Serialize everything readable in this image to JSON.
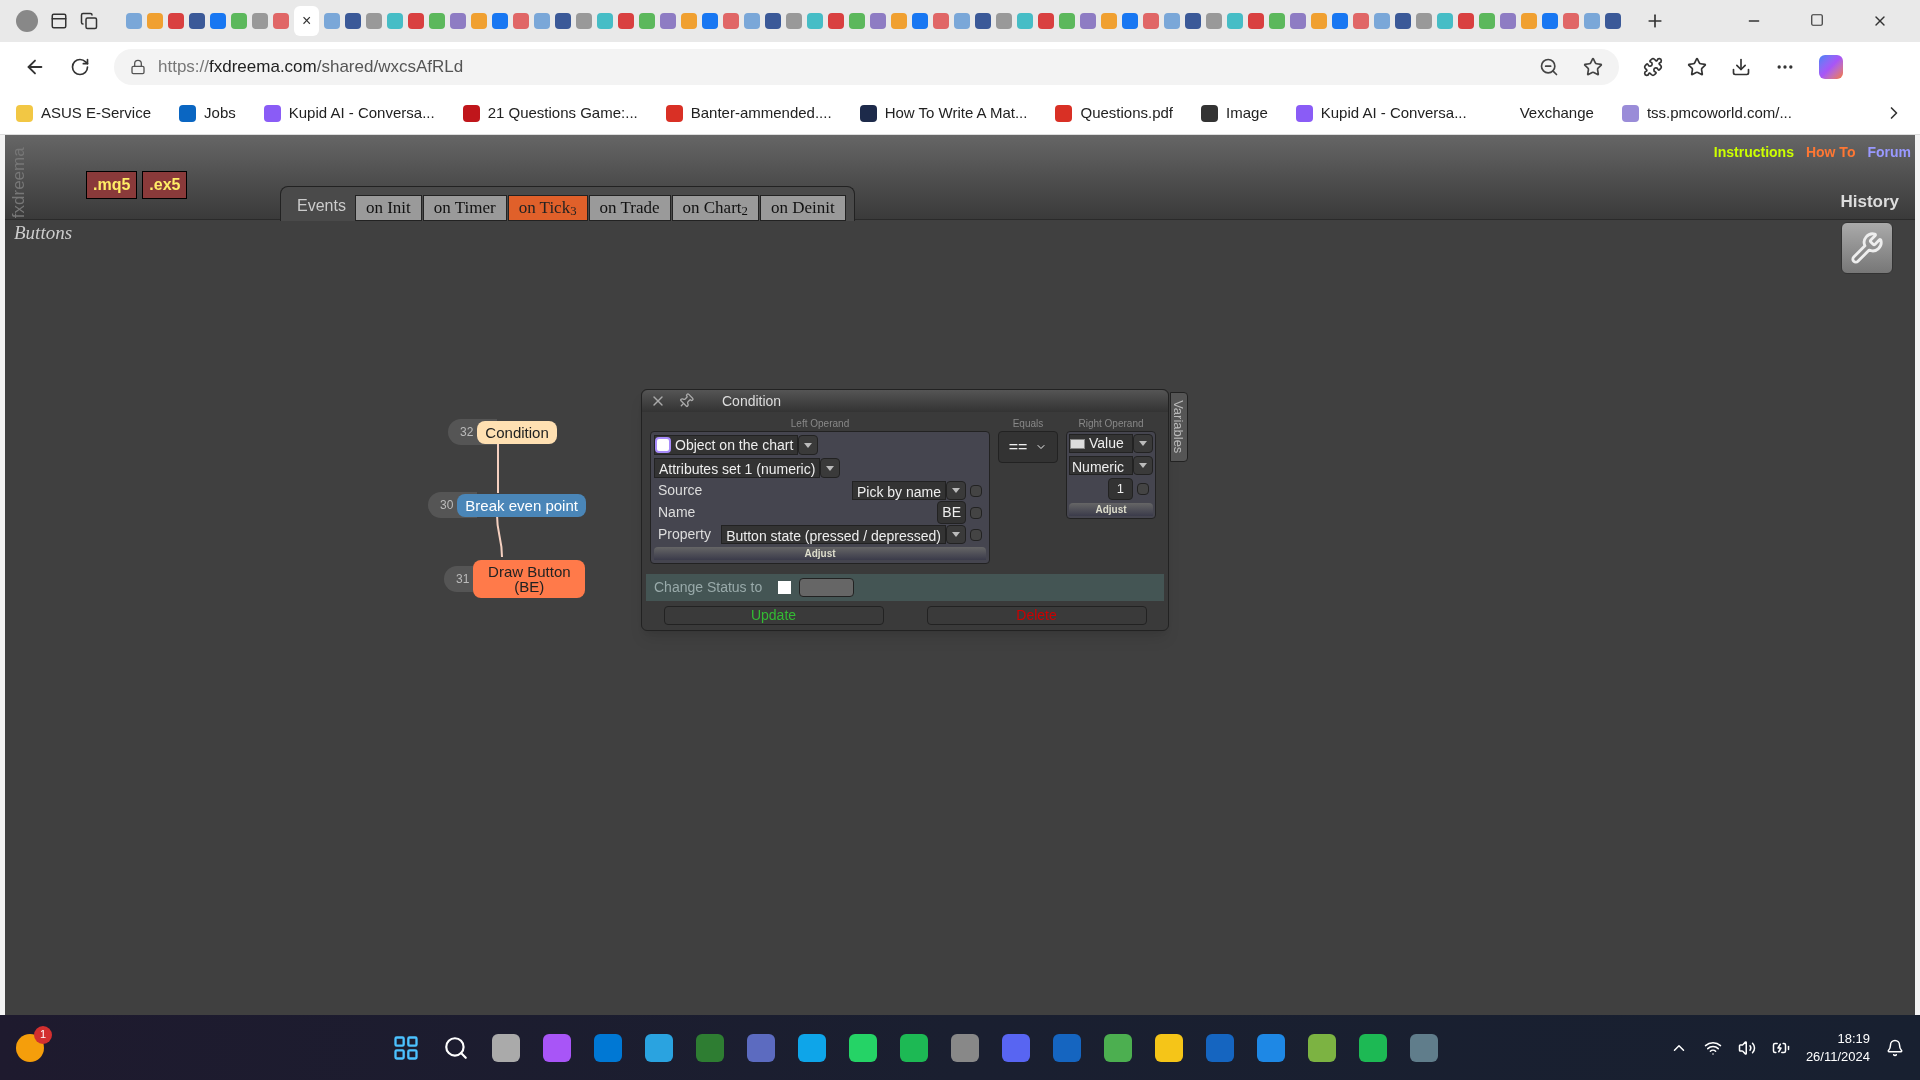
{
  "browser": {
    "active_tab_close": "×",
    "address": {
      "scheme": "https://",
      "host": "fxdreema.com",
      "path": "/shared/wxcsAfRLd"
    },
    "bookmarks": [
      {
        "label": "ASUS E-Service",
        "color": "#f2c744"
      },
      {
        "label": "Jobs",
        "color": "#0a66c2"
      },
      {
        "label": "Kupid AI - Conversa...",
        "color": "#8a5cf6"
      },
      {
        "label": "21 Questions Game:...",
        "color": "#c0161b"
      },
      {
        "label": "Banter-ammended....",
        "color": "#d93025"
      },
      {
        "label": "How To Write A Mat...",
        "color": "#1d2a4a"
      },
      {
        "label": "Questions.pdf",
        "color": "#d93025"
      },
      {
        "label": "Image",
        "color": "#333333"
      },
      {
        "label": "Kupid AI - Conversa...",
        "color": "#8a5cf6"
      },
      {
        "label": "Vexchange"
      },
      {
        "label": "tss.pmcoworld.com/...",
        "color": "#9a8cd8"
      }
    ]
  },
  "app": {
    "brand": "fxdreema",
    "exports": [
      ".mq5",
      ".ex5"
    ],
    "events_label": "Events",
    "tabs": [
      {
        "label": "on Init",
        "selected": false
      },
      {
        "label": "on Timer",
        "selected": false
      },
      {
        "label": "on Tick$_{3}$",
        "selected": true
      },
      {
        "label": "on Trade",
        "selected": false
      },
      {
        "label": "on Chart$_{2}$",
        "selected": false
      },
      {
        "label": "on Deinit",
        "selected": false
      }
    ],
    "links": [
      {
        "label": "Instructions",
        "color": "#ccff00"
      },
      {
        "label": "How To",
        "color": "#ff7733"
      },
      {
        "label": "Forum",
        "color": "#9999ff"
      }
    ],
    "history": "History",
    "project": "Buttons",
    "nodes": [
      {
        "number": "32",
        "label": "Condition",
        "color": "#ffe0b2"
      },
      {
        "number": "30",
        "label": "Break even point",
        "color": "#4a86b8"
      },
      {
        "number": "31",
        "label": "Draw Button (BE)",
        "color": "#ff7a4a"
      }
    ],
    "dialog": {
      "title": "Condition",
      "variables_tab": "Variables",
      "left": {
        "heading": "Left Operand",
        "type": "Object on the chart",
        "set": "Attributes set 1 (numeric)",
        "rows": [
          {
            "label": "Source",
            "value": "Pick by name",
            "kind": "select",
            "checked": false
          },
          {
            "label": "Name",
            "value": "BE",
            "kind": "text",
            "checked": false
          },
          {
            "label": "Property",
            "value": "Button state (pressed / depressed)",
            "kind": "select",
            "checked": false
          }
        ],
        "adjust": "Adjust"
      },
      "equals": {
        "heading": "Equals",
        "value": "=="
      },
      "right": {
        "heading": "Right Operand",
        "type": "Value",
        "format": "Numeric",
        "value": "1",
        "checked": false,
        "adjust": "Adjust"
      },
      "change_status": {
        "label": "Change Status to",
        "checked": false
      },
      "buttons": [
        {
          "label": "Update",
          "color": "#33bb33"
        },
        {
          "label": "Delete",
          "color": "#cc0000"
        }
      ]
    }
  },
  "taskbar": {
    "notification_badge": "1",
    "time": "18:19",
    "date": "26/11/2024"
  }
}
